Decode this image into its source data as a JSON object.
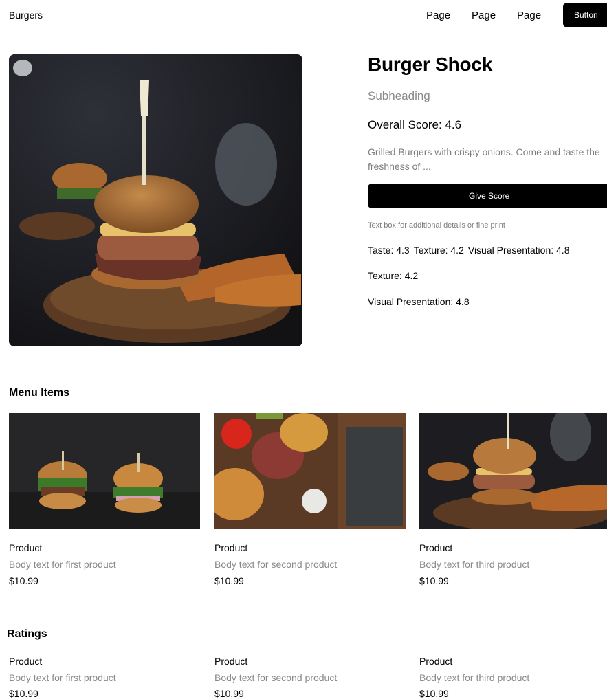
{
  "nav": {
    "brand": "Burgers",
    "links": [
      "Page",
      "Page",
      "Page"
    ],
    "button_label": "Button"
  },
  "hero": {
    "title": "Burger Shock",
    "subheading": "Subheading",
    "overall_score": "Overall Score: 4.6",
    "description": "Grilled Burgers with crispy onions. Come and taste the freshness of ...",
    "give_score_label": "Give Score",
    "fine_print": "Text box for additional details or fine print",
    "scores_inline": [
      "Taste: 4.3",
      "Texture: 4.2",
      "Visual Presentation: 4.8"
    ],
    "texture": "Texture: 4.2",
    "visual_presentation": "Visual Presentation: 4.8"
  },
  "menu": {
    "title": "Menu Items",
    "items": [
      {
        "name": "Product",
        "body": "Body text for first product",
        "price": "$10.99"
      },
      {
        "name": "Product",
        "body": "Body text for second product",
        "price": "$10.99"
      },
      {
        "name": "Product",
        "body": "Body text for third product",
        "price": "$10.99"
      }
    ]
  },
  "ratings": {
    "title": "Ratings",
    "items": [
      {
        "name": "Product",
        "body": "Body text for first product",
        "price": "$10.99"
      },
      {
        "name": "Product",
        "body": "Body text for second product",
        "price": "$10.99"
      },
      {
        "name": "Product",
        "body": "Body text for third product",
        "price": "$10.99"
      }
    ]
  },
  "colors": {
    "primary": "#000000",
    "muted_text": "#8a8a8a",
    "background": "#ffffff"
  }
}
